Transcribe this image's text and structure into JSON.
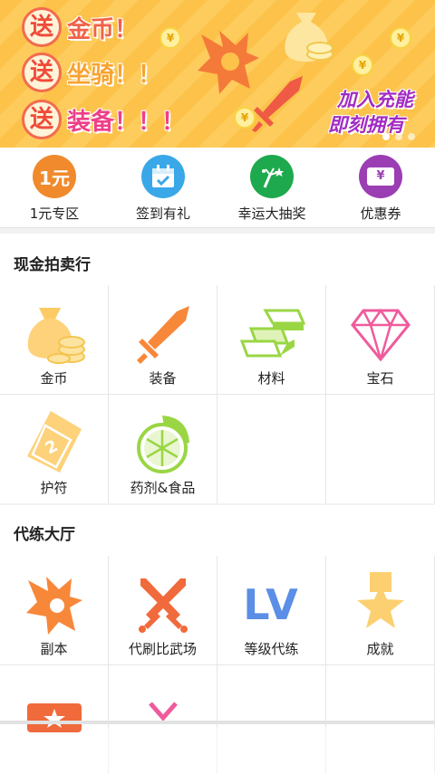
{
  "banner": {
    "lines": [
      "送金币！",
      "送坐骑！！",
      "送装备！！！"
    ],
    "song_char": "送",
    "promo_text": [
      "金币！",
      "坐骑！！",
      "装备！！！"
    ],
    "cta_line1": "加入充能",
    "cta_line2": "即刻拥有",
    "coin_symbol": "¥",
    "page_count": 3,
    "active_page": 1
  },
  "quick": [
    {
      "label": "1元专区",
      "icon": "one-yuan-icon",
      "icon_text": "1元",
      "color": "#f08a2c"
    },
    {
      "label": "签到有礼",
      "icon": "calendar-check-icon",
      "color": "#3aa8e8"
    },
    {
      "label": "幸运大抽奖",
      "icon": "fireworks-icon",
      "color": "#1ea94e"
    },
    {
      "label": "优惠券",
      "icon": "coupon-icon",
      "icon_text": "¥",
      "color": "#9b3eb3"
    }
  ],
  "auction": {
    "title": "现金拍卖行",
    "items": [
      {
        "label": "金币",
        "icon": "coin-bag-icon"
      },
      {
        "label": "装备",
        "icon": "sword-icon"
      },
      {
        "label": "材料",
        "icon": "gold-bars-icon"
      },
      {
        "label": "宝石",
        "icon": "diamond-icon"
      },
      {
        "label": "护符",
        "icon": "amulet-ticket-icon"
      },
      {
        "label": "药剂&食品",
        "icon": "lime-icon"
      },
      {
        "label": "",
        "icon": ""
      },
      {
        "label": "",
        "icon": ""
      }
    ]
  },
  "leveling": {
    "title": "代练大厅",
    "items": [
      {
        "label": "副本",
        "icon": "dragon-icon"
      },
      {
        "label": "代刷比武场",
        "icon": "crossed-swords-icon"
      },
      {
        "label": "等级代练",
        "icon": "lv-icon",
        "icon_text": "LV"
      },
      {
        "label": "成就",
        "icon": "star-medal-icon"
      }
    ]
  },
  "colors": {
    "orange": "#f7883a",
    "gold": "#fcd071",
    "pink": "#ef5b9c",
    "lime": "#9ad644",
    "blue": "#5b8ee6"
  }
}
